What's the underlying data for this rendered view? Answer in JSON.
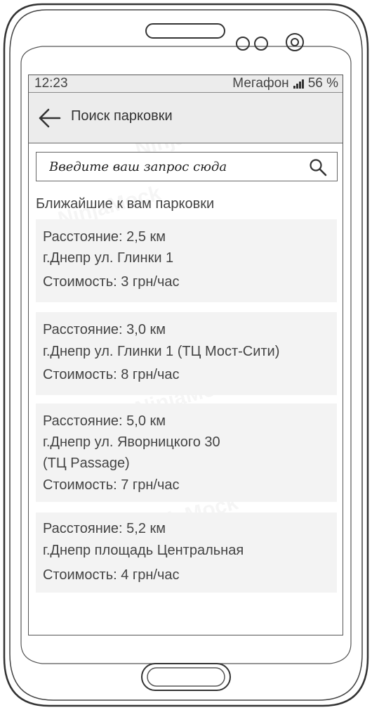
{
  "status_bar": {
    "time": "12:23",
    "carrier": "Мегафон",
    "battery": "56 %"
  },
  "app_bar": {
    "title": "Поиск парковки",
    "back_icon": "arrow-left-icon"
  },
  "search": {
    "placeholder": "Введите ваш запрос сюда",
    "icon": "search-icon"
  },
  "section": {
    "title": "Ближайшие к вам парковки"
  },
  "parkings": [
    {
      "distance": "Расстояние: 2,5 км",
      "address": "г.Днепр ул. Глинки 1",
      "address2": "",
      "price": "Стоимость: 3 грн/час"
    },
    {
      "distance": "Расстояние: 3,0 км",
      "address": "г.Днепр ул. Глинки 1 (ТЦ Мост-Сити)",
      "address2": "",
      "price": "Стоимость: 8 грн/час"
    },
    {
      "distance": "Расстояние: 5,0 км",
      "address": "г.Днепр ул. Яворницкого 30",
      "address2": "(ТЦ Passage)",
      "price": "Стоимость: 7 грн/час"
    },
    {
      "distance": "Расстояние: 5,2 км",
      "address": "г.Днепр площадь Центральная",
      "address2": "",
      "price": "Стоимость: 4 грн/час"
    }
  ]
}
